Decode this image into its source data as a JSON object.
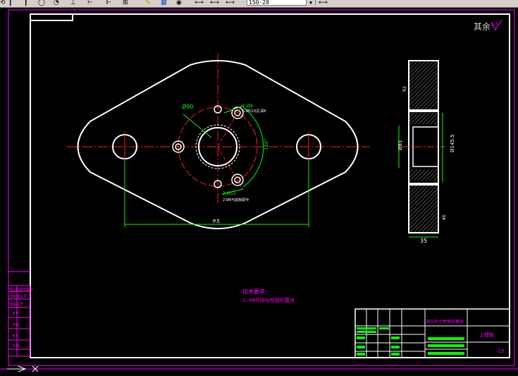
{
  "toolbar": {
    "icons": [
      "zoom-pan-icon",
      "circle-tool-icon",
      "rotate-tool-icon",
      "text-tool-icon",
      "line-tool-icon",
      "dimension-icon",
      "table-icon",
      "pencil-icon",
      "layer-icon",
      "properties-icon",
      "dim-linear-icon",
      "dim-aligned-icon",
      "dim-angular-icon",
      "dim-style-icon"
    ],
    "dim_style_value": "150-20"
  },
  "drawing": {
    "roughness_label": "其余",
    "roughness_symbol": "6.3",
    "dim_hole_diameter": "Ø90",
    "dim_small_holes": "2-Ø52",
    "dim_small_holes_note": "2-Ø52沉孔深8",
    "dim_pin_holes": "2-Ø9",
    "dim_pin_holes_note": "2-Ø8与底板配作",
    "dim_angle": "120°",
    "dim_pcd": "P.5",
    "side_top_note": "R2",
    "side_dim_left": "Ø81",
    "side_dim_right": "Ø145.5",
    "side_dim_bottom": "40",
    "side_width": "35",
    "tech_title": "技术要求:",
    "tech_line1": "1. 98件同与性图形模块",
    "title_block_name": "冲中尺寸性图形模块",
    "title_block_part": "上模板",
    "title_block_number": "-15"
  },
  "side_panel": {
    "rows": [
      "借(通)用件登记",
      "旧底图总号",
      "底图总号",
      "签字",
      "日期",
      "签字",
      "日期"
    ]
  }
}
